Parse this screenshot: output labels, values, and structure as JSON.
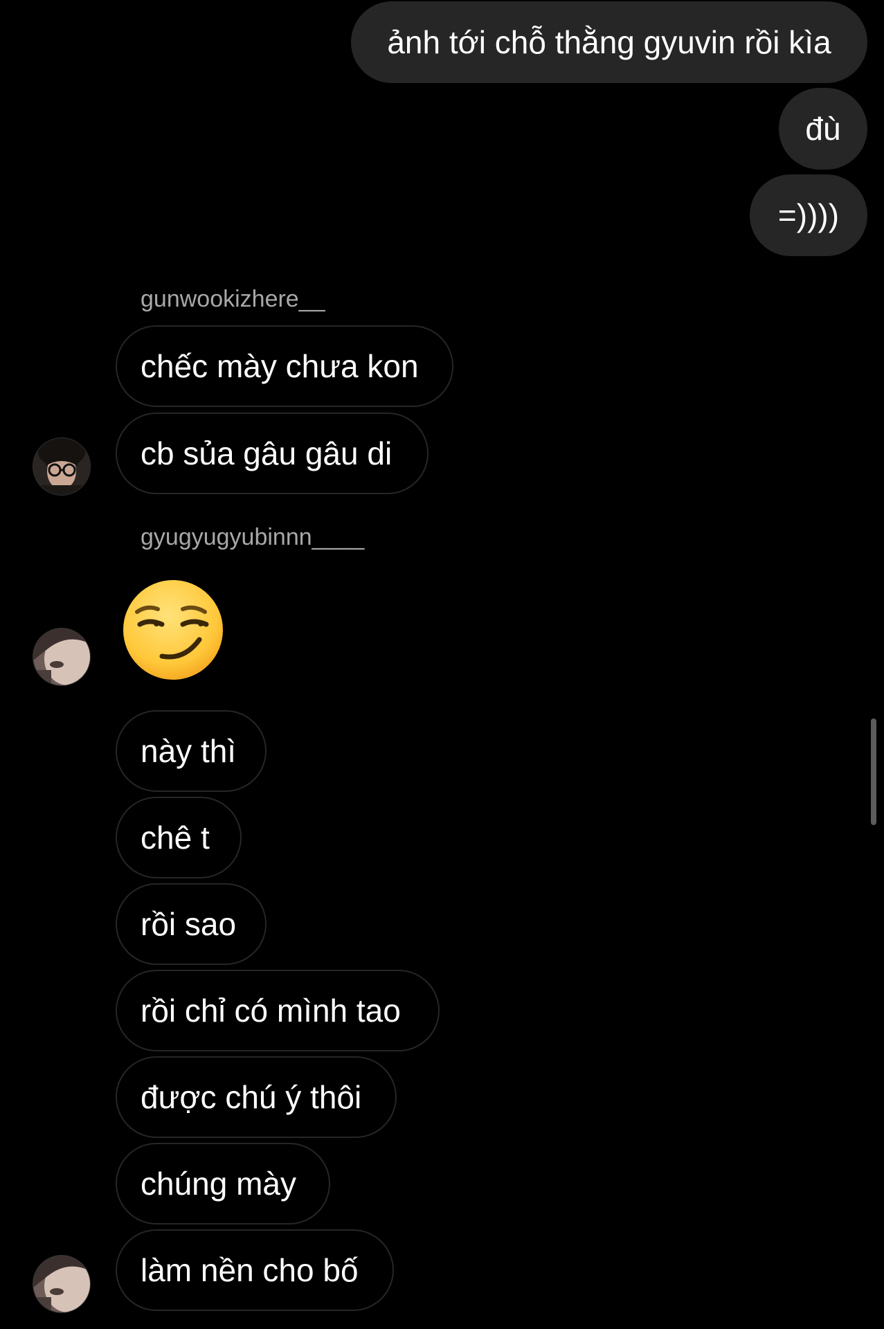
{
  "colors": {
    "background": "#000000",
    "outgoing_bubble": "#262626",
    "incoming_border": "#262626",
    "text": "#ffffff",
    "sender_name": "#a8a8a8",
    "scrollbar": "#5c5c5c"
  },
  "outgoing": [
    {
      "text": "ảnh tới chỗ thằng gyuvin rồi kìa"
    },
    {
      "text": "đù"
    },
    {
      "text": "=))))"
    }
  ],
  "group1": {
    "sender": "gunwookizhere__",
    "avatar_icon": "profile-photo-glasses",
    "messages": [
      {
        "text": "chếc mày chưa kon"
      },
      {
        "text": "cb sủa gâu gâu di"
      }
    ]
  },
  "group2": {
    "sender": "gyugyugyubinnn____",
    "avatar_icon": "profile-photo",
    "emoji": "smirking-face-emoji",
    "messages": [
      {
        "text": "này thì"
      },
      {
        "text": "chê t"
      },
      {
        "text": "rồi sao"
      },
      {
        "text": "rồi chỉ có mình tao"
      },
      {
        "text": "được chú ý thôi"
      },
      {
        "text": "chúng mày"
      },
      {
        "text": "làm nền cho bố"
      }
    ]
  }
}
